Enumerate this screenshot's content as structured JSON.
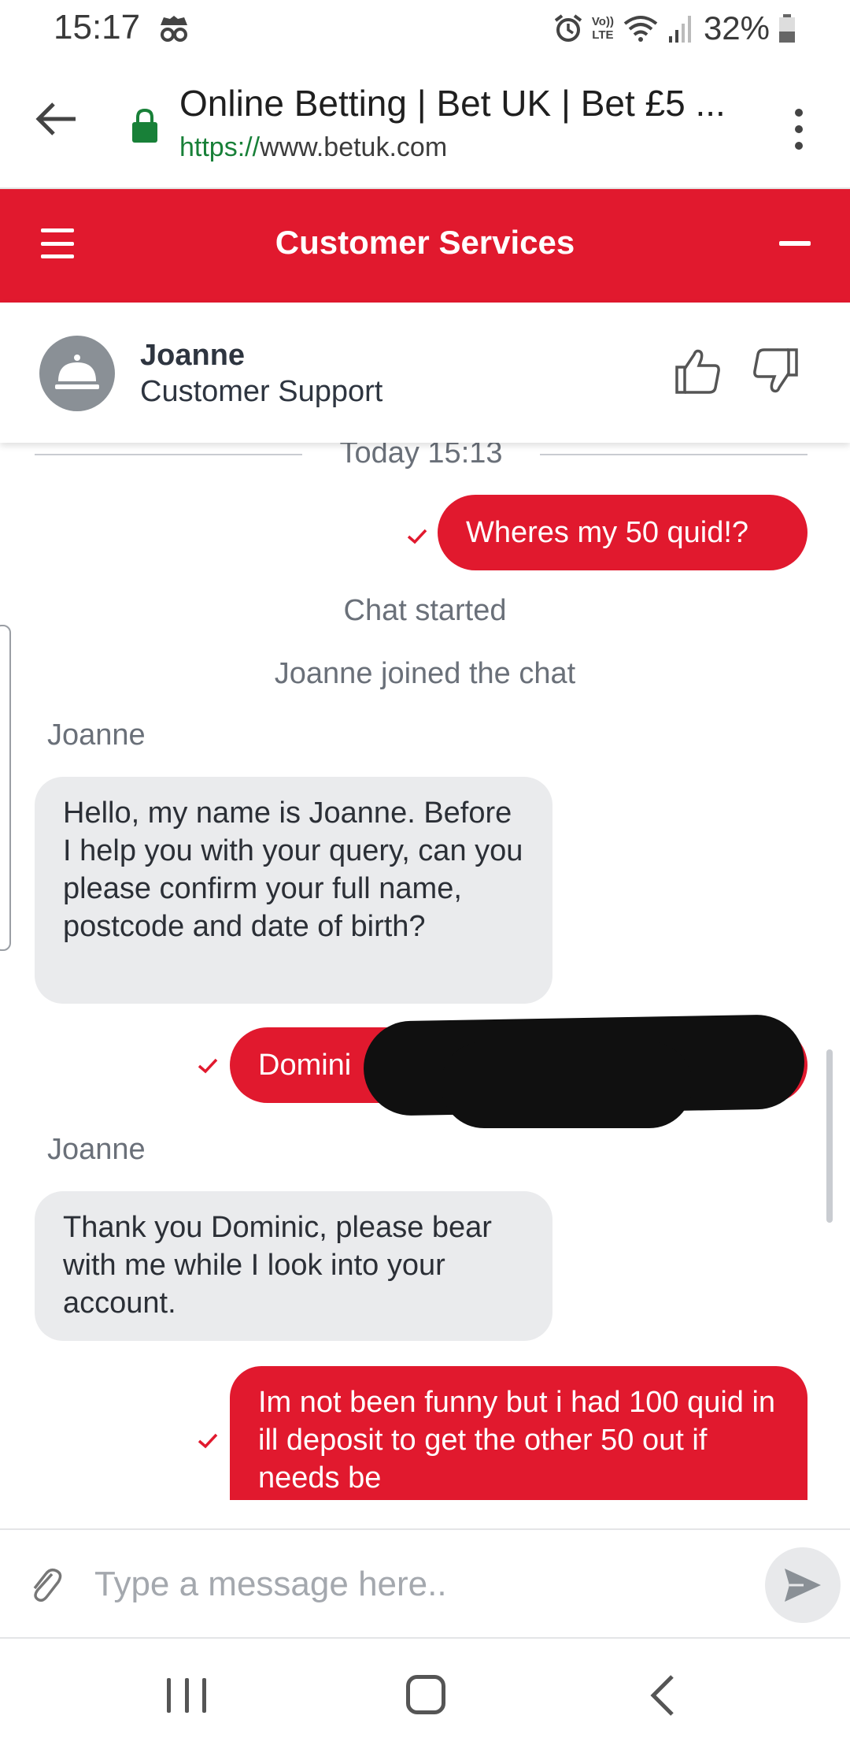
{
  "status_bar": {
    "time": "15:17",
    "battery": "32%",
    "icons": [
      "incognito-icon",
      "alarm-icon",
      "volte-icon",
      "wifi-icon",
      "signal-icon",
      "battery-icon"
    ],
    "network_label_top": "Vo))",
    "network_label_bottom": "LTE"
  },
  "browser": {
    "title": "Online Betting | Bet UK | Bet £5 ...",
    "url_scheme": "https://",
    "url_host": "www.betuk.com",
    "lock_color": "#188038"
  },
  "header": {
    "title": "Customer Services",
    "accent_color": "#e1192e"
  },
  "agent": {
    "name": "Joanne",
    "role": "Customer Support"
  },
  "chat": {
    "date_separator": "Today 15:13",
    "messages": [
      {
        "type": "outgoing",
        "text": "Wheres my 50 quid!?"
      },
      {
        "type": "system",
        "text": "Chat started"
      },
      {
        "type": "system",
        "text": "Joanne joined the chat"
      },
      {
        "type": "incoming",
        "sender": "Joanne",
        "text": "Hello, my name is Joanne. Before I help you with your query, can you please confirm your full name, postcode and date of birth?"
      },
      {
        "type": "outgoing",
        "text": "Domini",
        "redacted": true
      },
      {
        "type": "incoming",
        "sender": "Joanne",
        "text": "Thank you Dominic, please bear with me while I look into your account."
      },
      {
        "type": "outgoing",
        "text": "Im not been funny but i had 100 quid in ill deposit to get the other 50 out if needs be"
      }
    ]
  },
  "composer": {
    "placeholder": "Type a message here.."
  }
}
